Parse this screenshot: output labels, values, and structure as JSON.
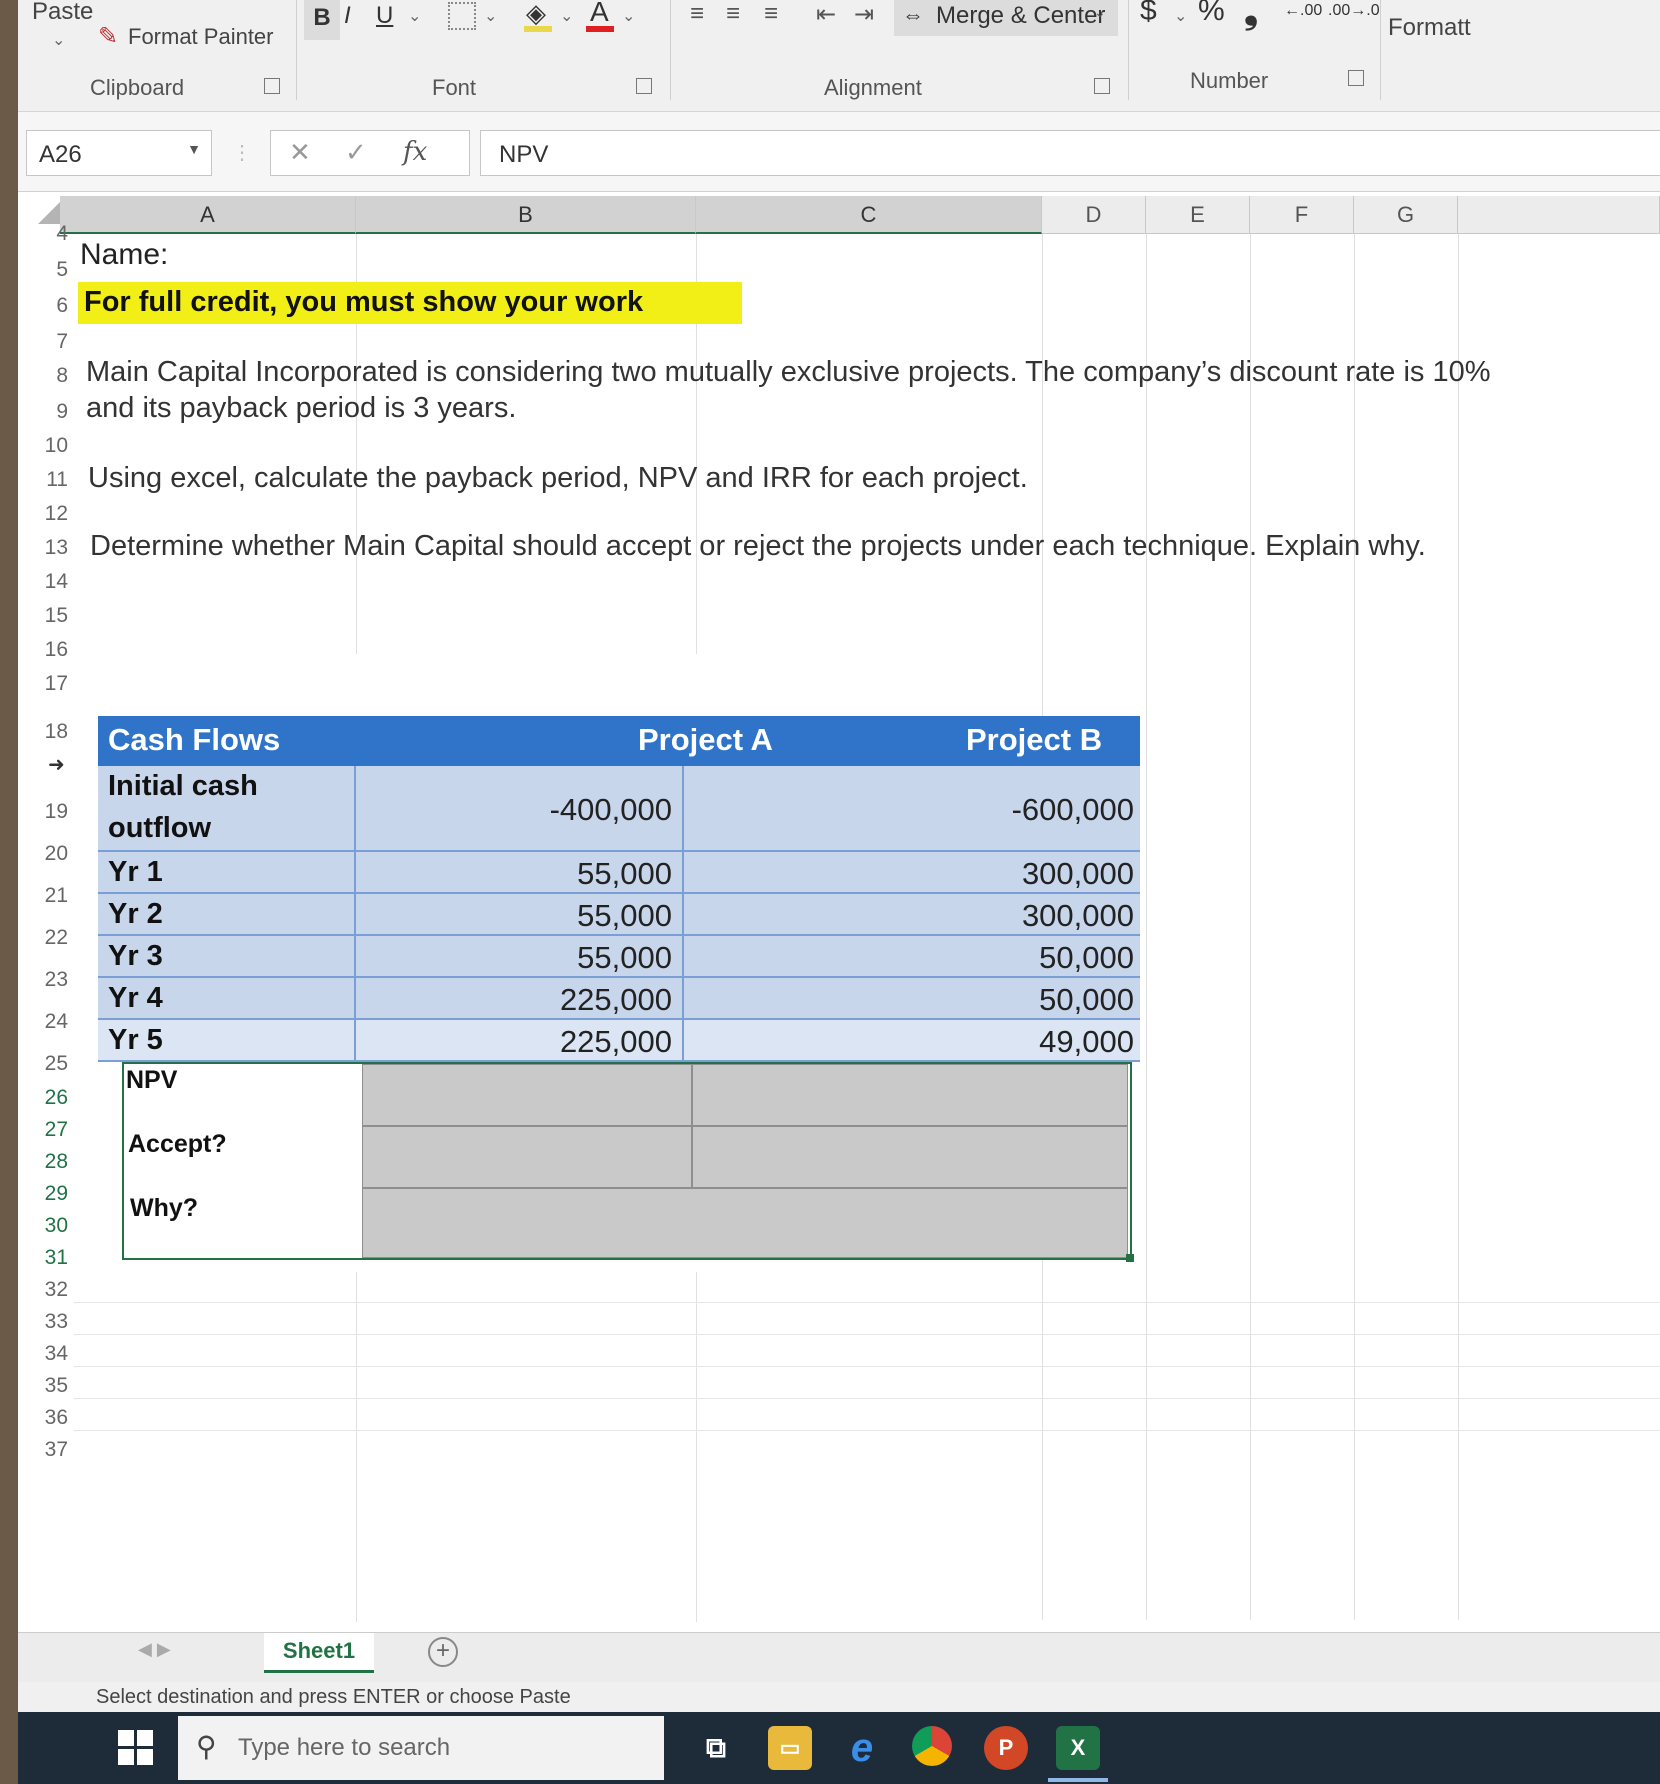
{
  "ribbon": {
    "paste_label": "Paste",
    "format_painter": "Format Painter",
    "clipboard_group": "Clipboard",
    "bold": "B",
    "italic": "I",
    "underline": "U",
    "font_group": "Font",
    "merge_center": "Merge & Center",
    "alignment_group": "Alignment",
    "currency": "$",
    "percent": "%",
    "comma": "❟",
    "number_group": "Number",
    "formatting_partial": "Formatt"
  },
  "formula_bar": {
    "name_box": "A26",
    "formula": "NPV",
    "fx": "fx"
  },
  "columns": [
    "A",
    "B",
    "C",
    "D",
    "E",
    "F",
    "G"
  ],
  "rows": [
    "4",
    "5",
    "6",
    "7",
    "8",
    "9",
    "10",
    "11",
    "12",
    "13",
    "14",
    "15",
    "16",
    "17",
    "18",
    "19",
    "20",
    "21",
    "22",
    "23",
    "24",
    "25",
    "26",
    "27",
    "28",
    "29",
    "30",
    "31",
    "32",
    "33",
    "34",
    "35",
    "36",
    "37"
  ],
  "sheet": {
    "name_label": "Name:",
    "instruction": "For full credit, you must show your work",
    "para1_line1": "Main Capital Incorporated is considering two mutually exclusive projects. The company’s discount rate is 10%",
    "para1_line2": "and its payback period is 3 years.",
    "para2": "Using excel, calculate the payback period, NPV and IRR for each project.",
    "para3": "Determine whether Main Capital should accept or reject the projects under each technique. Explain why."
  },
  "cash_flows": {
    "header": [
      "Cash Flows",
      "Project A",
      "Project B"
    ],
    "rows": [
      {
        "label_line1": "Initial cash",
        "label_line2": "outflow",
        "a": "-400,000",
        "b": "-600,000"
      },
      {
        "label": "Yr 1",
        "a": "55,000",
        "b": "300,000"
      },
      {
        "label": "Yr 2",
        "a": "55,000",
        "b": "300,000"
      },
      {
        "label": "Yr 3",
        "a": "55,000",
        "b": "50,000"
      },
      {
        "label": "Yr 4",
        "a": "225,000",
        "b": "50,000"
      },
      {
        "label": "Yr 5",
        "a": "225,000",
        "b": "49,000"
      }
    ]
  },
  "answers": {
    "npv": "NPV",
    "accept": "Accept?",
    "why": "Why?"
  },
  "tabs": {
    "sheet1": "Sheet1",
    "add": "+"
  },
  "status_bar": "Select destination and press ENTER or choose Paste",
  "taskbar": {
    "search_placeholder": "Type here to search",
    "powerpoint_letter": "P",
    "excel_letter": "X"
  },
  "colors": {
    "excel_green": "#217346",
    "table_header_blue": "#2f74c8",
    "table_row_blue": "#c8d6ec",
    "highlight_yellow": "#f2ef17",
    "answer_gray": "#c9c9c9"
  }
}
